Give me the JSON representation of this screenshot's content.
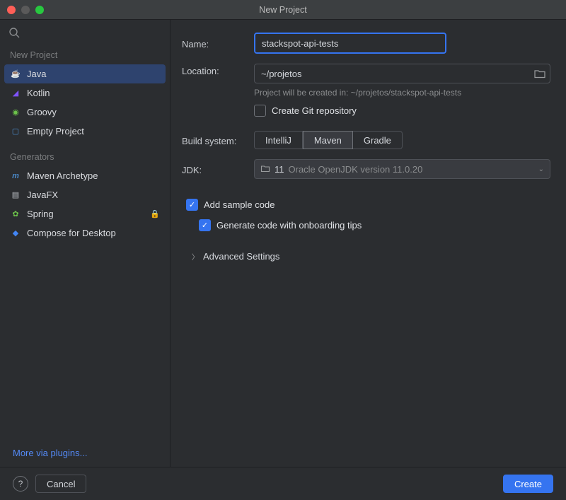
{
  "window": {
    "title": "New Project"
  },
  "sidebar": {
    "section_new": "New Project",
    "items": [
      {
        "label": "Java",
        "icon": "java-icon",
        "selected": true
      },
      {
        "label": "Kotlin",
        "icon": "kotlin-icon"
      },
      {
        "label": "Groovy",
        "icon": "groovy-icon"
      },
      {
        "label": "Empty Project",
        "icon": "empty-icon"
      }
    ],
    "section_gen": "Generators",
    "generators": [
      {
        "label": "Maven Archetype",
        "icon": "maven-icon"
      },
      {
        "label": "JavaFX",
        "icon": "javafx-icon"
      },
      {
        "label": "Spring",
        "icon": "spring-icon",
        "locked": true
      },
      {
        "label": "Compose for Desktop",
        "icon": "compose-icon"
      }
    ],
    "more": "More via plugins..."
  },
  "form": {
    "name_label": "Name:",
    "name_value": "stackspot-api-tests",
    "location_label": "Location:",
    "location_value": "~/projetos",
    "location_hint": "Project will be created in: ~/projetos/stackspot-api-tests",
    "git_label": "Create Git repository",
    "build_label": "Build system:",
    "build_options": [
      "IntelliJ",
      "Maven",
      "Gradle"
    ],
    "build_selected": "Maven",
    "jdk_label": "JDK:",
    "jdk_value": "11",
    "jdk_desc": "Oracle OpenJDK version 11.0.20",
    "sample_label": "Add sample code",
    "onboard_label": "Generate code with onboarding tips",
    "advanced": "Advanced Settings"
  },
  "footer": {
    "cancel": "Cancel",
    "create": "Create"
  }
}
